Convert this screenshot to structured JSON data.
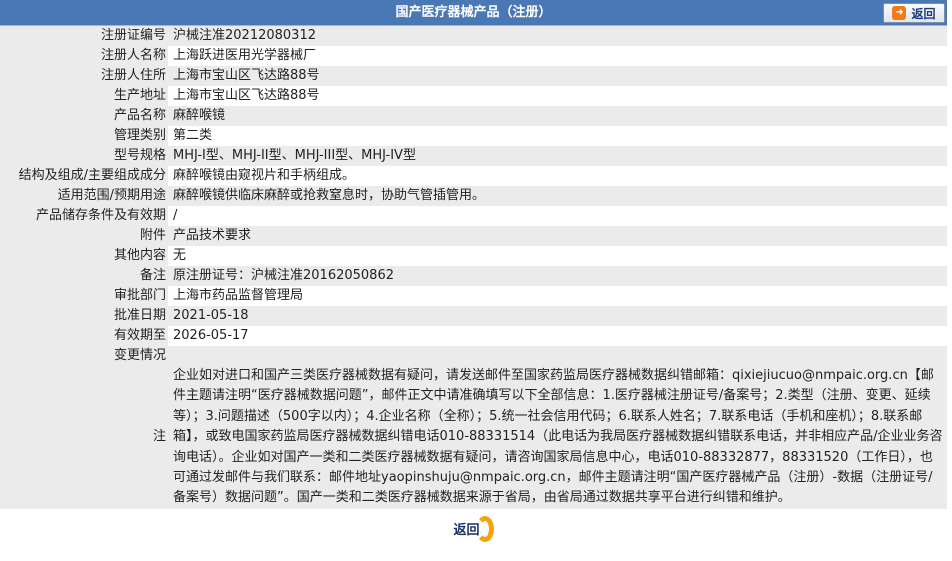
{
  "header": {
    "title": "国产医疗器械产品（注册）",
    "back_label": "返回"
  },
  "fields": [
    {
      "label": "注册证编号",
      "value": "沪械注准20212080312"
    },
    {
      "label": "注册人名称",
      "value": "上海跃进医用光学器械厂"
    },
    {
      "label": "注册人住所",
      "value": "上海市宝山区飞达路88号"
    },
    {
      "label": "生产地址",
      "value": "上海市宝山区飞达路88号"
    },
    {
      "label": "产品名称",
      "value": "麻醉喉镜"
    },
    {
      "label": "管理类别",
      "value": "第二类"
    },
    {
      "label": "型号规格",
      "value": "MHJ-I型、MHJ-II型、MHJ-III型、MHJ-IV型"
    },
    {
      "label": "结构及组成/主要组成成分",
      "value": "麻醉喉镜由窥视片和手柄组成。"
    },
    {
      "label": "适用范围/预期用途",
      "value": "麻醉喉镜供临床麻醉或抢救窒息时，协助气管插管用。"
    },
    {
      "label": "产品储存条件及有效期",
      "value": "/"
    },
    {
      "label": "附件",
      "value": "产品技术要求"
    },
    {
      "label": "其他内容",
      "value": "无"
    },
    {
      "label": "备注",
      "value": "原注册证号：沪械注准20162050862"
    },
    {
      "label": "审批部门",
      "value": "上海市药品监督管理局"
    },
    {
      "label": "批准日期",
      "value": "2021-05-18"
    },
    {
      "label": "有效期至",
      "value": "2026-05-17"
    },
    {
      "label": "变更情况",
      "value": ""
    }
  ],
  "note": {
    "label": "注",
    "text": "企业如对进口和国产三类医疗器械数据有疑问，请发送邮件至国家药监局医疗器械数据纠错邮箱：qixiejiucuo@nmpaic.org.cn【邮件主题请注明“医疗器械数据问题”，邮件正文中请准确填写以下全部信息：1.医疗器械注册证号/备案号；2.类型（注册、变更、延续等）；3.问题描述（500字以内）；4.企业名称（全称）；5.统一社会信用代码；6.联系人姓名；7.联系电话（手机和座机）；8.联系邮箱】，或致电国家药监局医疗器械数据纠错电话010-88331514（此电话为我局医疗器械数据纠错联系电话，并非相应产品/企业业务咨询电话）。企业如对国产一类和二类医疗器械数据有疑问，请咨询国家局信息中心，电话010-88332877，88331520（工作日），也可通过发邮件与我们联系：邮件地址yaopinshuju@nmpaic.org.cn，邮件主题请注明“国产医疗器械产品（注册）-数据（注册证号/备案号）数据问题”。国产一类和二类医疗器械数据来源于省局，由省局通过数据共享平台进行纠错和维护。"
  },
  "footer": {
    "back_label": "返回"
  },
  "colors": {
    "header_bg": "#4a78b4",
    "row_gray": "#ebebeb",
    "accent_orange": "#f5a20f"
  },
  "icons": {
    "back_top": "arrow-right-icon",
    "back_bottom": "ring-icon"
  }
}
